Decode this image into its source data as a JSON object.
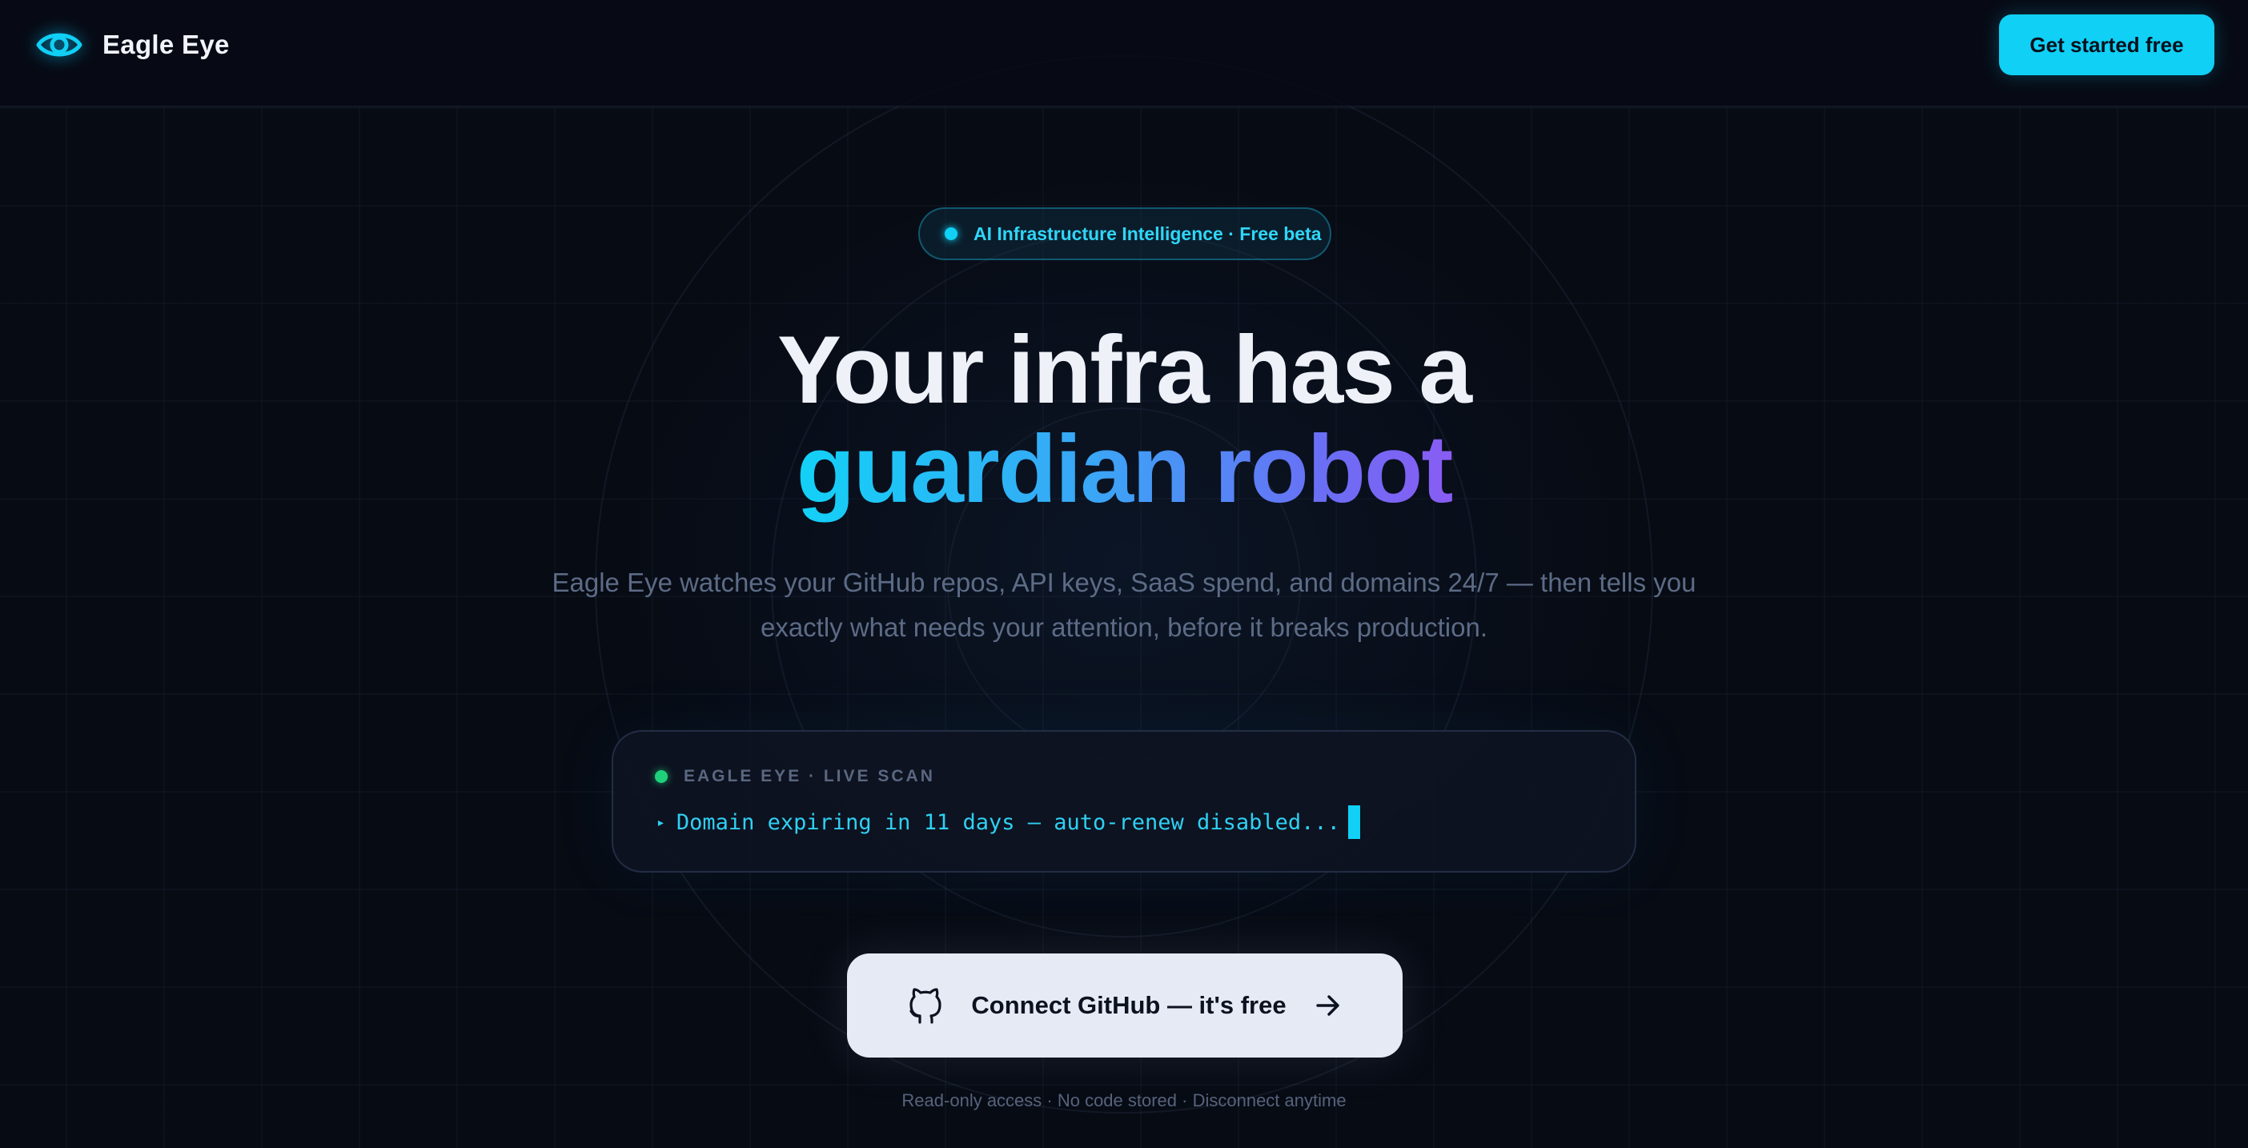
{
  "header": {
    "brand_name": "Eagle Eye",
    "brand_icon": "eye-icon",
    "cta_label": "Get started free"
  },
  "hero": {
    "badge_text": "AI Infrastructure Intelligence · Free beta",
    "headline_line1": "Your infra has a",
    "headline_line2": "guardian robot",
    "subtitle": "Eagle Eye watches your GitHub repos, API keys, SaaS spend, and domains 24/7 — then tells you exactly what needs your attention, before it breaks production."
  },
  "scan": {
    "label": "EAGLE EYE · LIVE SCAN",
    "prompt_icon": "play-triangle-icon",
    "message": "Domain expiring in 11 days — auto-renew disabled..."
  },
  "main_cta": {
    "icon": "github-icon",
    "label": "Connect GitHub — it's free",
    "arrow_icon": "arrow-right-icon"
  },
  "footnote": "Read-only access · No code stored · Disconnect anytime",
  "colors": {
    "background": "#070b14",
    "accent": "#10d0f6",
    "gradient_start": "#12d2f7",
    "gradient_end": "#8a5cf4",
    "live_status": "#1fd07a",
    "cta_main_bg": "#e6eaf4"
  }
}
